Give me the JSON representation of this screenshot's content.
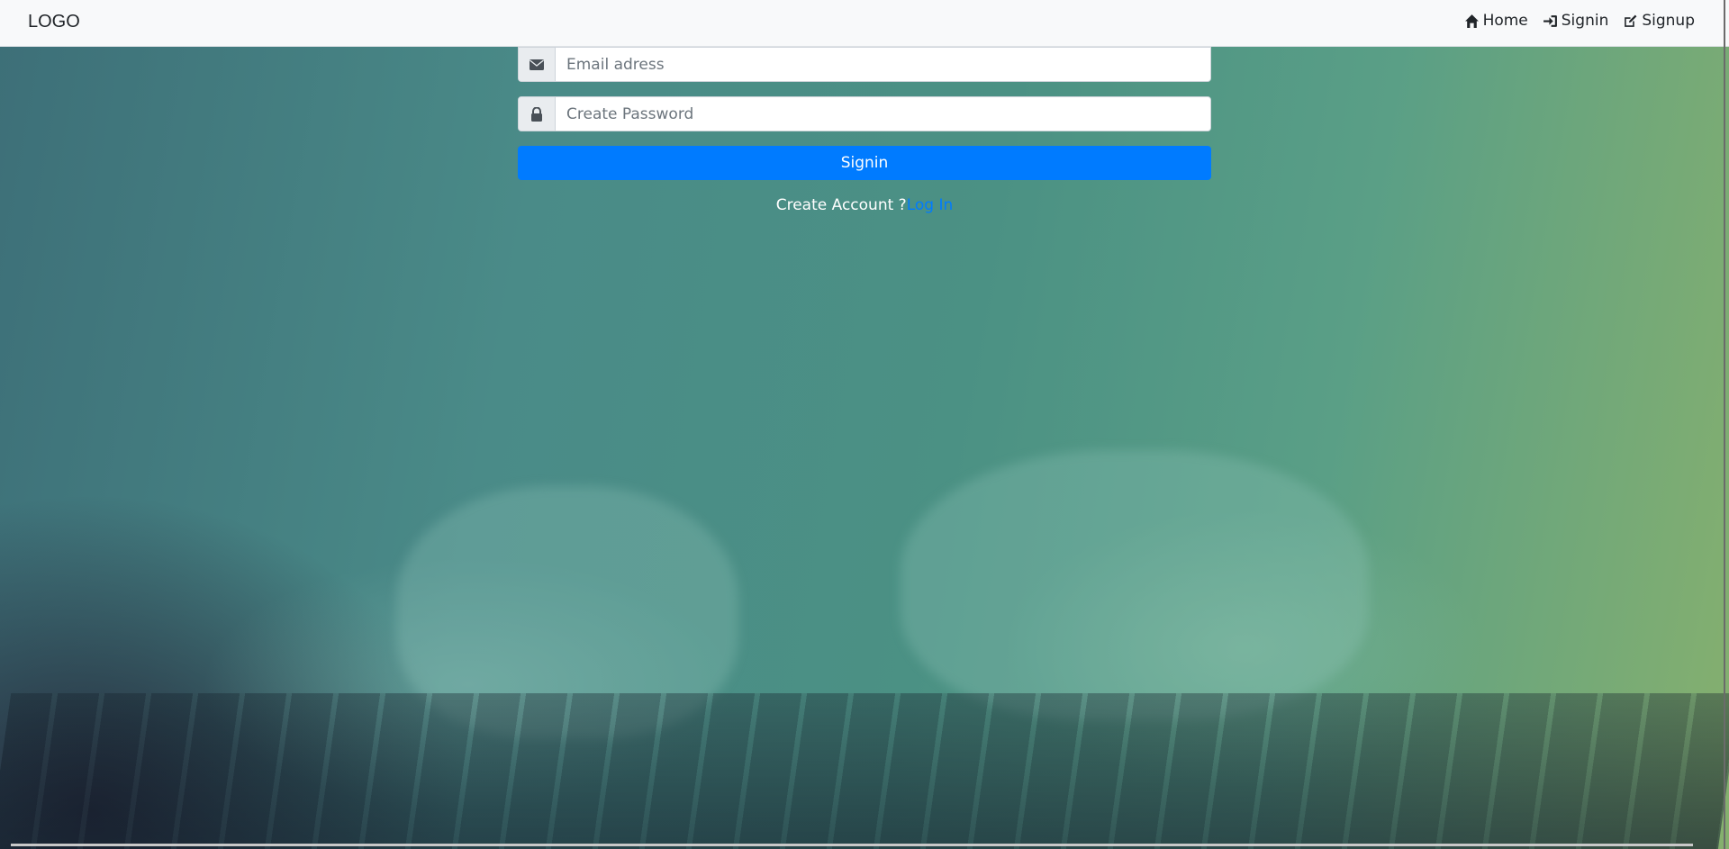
{
  "navbar": {
    "logo": "LOGO",
    "items": [
      {
        "label": "Home",
        "icon": "home-icon"
      },
      {
        "label": "Signin",
        "icon": "sign-in-icon"
      },
      {
        "label": "Signup",
        "icon": "edit-icon"
      }
    ]
  },
  "form": {
    "email": {
      "placeholder": "Email adress",
      "value": "",
      "icon": "envelope-icon"
    },
    "password": {
      "placeholder": "Create Password",
      "value": "",
      "icon": "lock-icon"
    },
    "submit_label": "Signin",
    "account_prompt": "Create Account ?",
    "login_link": "Log In"
  },
  "colors": {
    "primary": "#007bff",
    "navbar_bg": "#f8f9fa"
  }
}
